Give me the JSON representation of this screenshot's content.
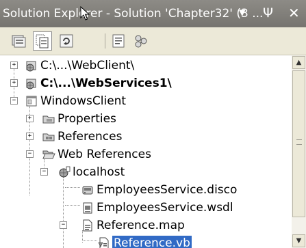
{
  "window": {
    "title": "Solution Explorer - Solution 'Chapter32' (3 ...",
    "dropdown_glyph": "▾",
    "pin_glyph": "Ψ",
    "close_glyph": "✕"
  },
  "toolbar": {
    "buttons": [
      {
        "name": "properties-icon"
      },
      {
        "name": "show-all-files-icon",
        "pressed": true
      },
      {
        "name": "refresh-icon"
      },
      {
        "name": "view-code-icon"
      },
      {
        "name": "class-view-icon"
      }
    ]
  },
  "tree": {
    "items": [
      {
        "label": "C:\\...\\WebClient\\",
        "bold": false,
        "expander": "+",
        "icon": "web-project-icon"
      },
      {
        "label": "C:\\...\\WebServices1\\",
        "bold": true,
        "expander": "+",
        "icon": "web-project-icon"
      },
      {
        "label": "WindowsClient",
        "bold": false,
        "expander": "−",
        "icon": "windows-project-icon"
      },
      {
        "label": "Properties",
        "expander": "+",
        "icon": "properties-folder-icon"
      },
      {
        "label": "References",
        "expander": "+",
        "icon": "references-folder-icon"
      },
      {
        "label": "Web References",
        "expander": "−",
        "icon": "folder-open-icon"
      },
      {
        "label": "localhost",
        "expander": "−",
        "icon": "web-reference-icon"
      },
      {
        "label": "EmployeesService.disco",
        "icon": "disco-file-icon"
      },
      {
        "label": "EmployeesService.wsdl",
        "icon": "wsdl-file-icon"
      },
      {
        "label": "Reference.map",
        "expander": "−",
        "icon": "map-file-icon"
      },
      {
        "label": "Reference.vb",
        "icon": "vb-file-icon",
        "selected": true
      }
    ]
  },
  "colors": {
    "titlebar": "#827f7a",
    "toolbar": "#ece9d8",
    "selection": "#316ac5"
  }
}
